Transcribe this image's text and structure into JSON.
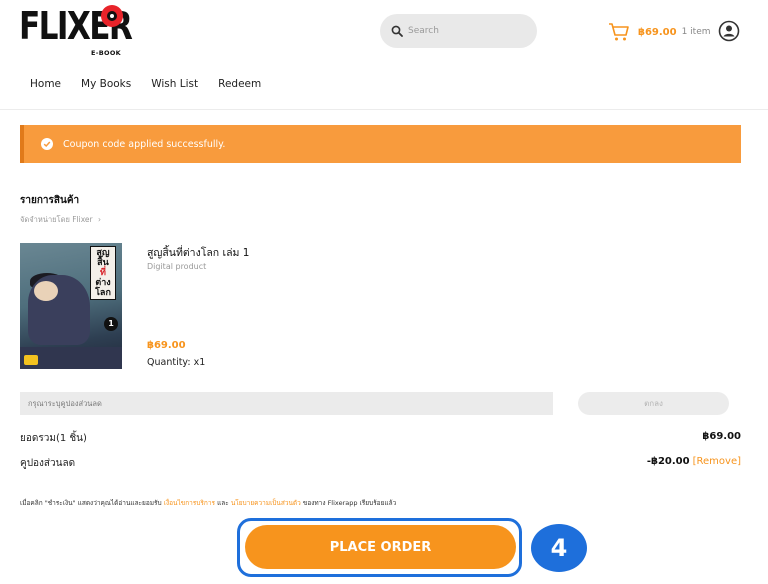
{
  "brand": {
    "name": "FLIXER",
    "sub": "E-BOOK"
  },
  "search": {
    "placeholder": "Search"
  },
  "cart": {
    "total": "฿69.00",
    "count": "1 item"
  },
  "nav": {
    "items": [
      {
        "label": "Home"
      },
      {
        "label": "My Books"
      },
      {
        "label": "Wish List"
      },
      {
        "label": "Redeem"
      }
    ]
  },
  "alert": {
    "message": "Coupon code applied successfully."
  },
  "order": {
    "section_title": "รายการสินค้า",
    "seller": "จัดจำหน่ายโดย Flixer",
    "product": {
      "title": "สูญสิ้นที่ต่างโลก เล่ม 1",
      "type": "Digital product",
      "price": "฿69.00",
      "quantity": "Quantity: x1",
      "cover_text": {
        "line1": "สูญ",
        "line2": "สิ้น",
        "line3": "ที่",
        "line4": "ต่าง",
        "line5": "โลก",
        "volume": "1"
      }
    },
    "coupon": {
      "placeholder": "กรุณาระบุคูปองส่วนลด",
      "apply_label": "ตกลง"
    },
    "subtotal_label": "ยอดรวม(1 ชิ้น)",
    "subtotal_value": "฿69.00",
    "discount_label": "คูปองส่วนลด",
    "discount_value": "-฿20.00",
    "remove_label": "[Remove]",
    "terms": {
      "prefix": "เมื่อคลิก \"ชำระเงิน\" แสดงว่าคุณได้อ่านและยอมรับ",
      "link1": "เงื่อนไขการบริการ",
      "middle": "และ",
      "link2": "นโยบายความเป็นส่วนตัว",
      "suffix": "ของทาง Flixerapp เรียบร้อยแล้ว"
    },
    "place_order_label": "PLACE ORDER",
    "step_number": "4"
  },
  "colors": {
    "accent": "#f7941d",
    "alert": "#f89b3d",
    "highlight": "#1e6fdb"
  }
}
